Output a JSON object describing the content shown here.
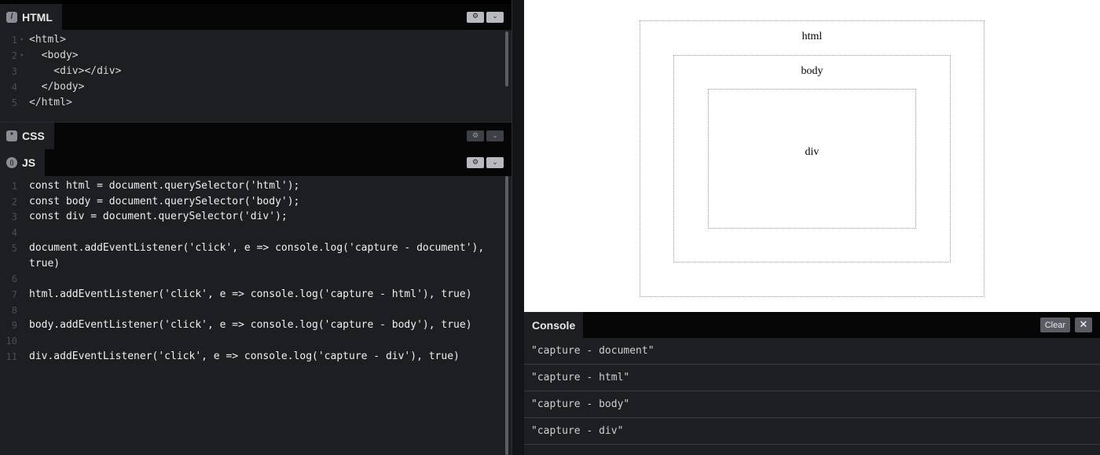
{
  "editors": {
    "html": {
      "tab_label": "HTML",
      "tab_icon": "/",
      "lines": [
        {
          "n": "1",
          "fold": "▾",
          "text": "<html>"
        },
        {
          "n": "2",
          "fold": "▾",
          "text": "  <body>"
        },
        {
          "n": "3",
          "fold": "",
          "text": "    <div></div>"
        },
        {
          "n": "4",
          "fold": "",
          "text": "  </body>"
        },
        {
          "n": "5",
          "fold": "",
          "text": "</html>"
        }
      ]
    },
    "css": {
      "tab_label": "CSS",
      "tab_icon": "*"
    },
    "js": {
      "tab_label": "JS",
      "tab_icon": "()",
      "lines": [
        {
          "n": "1",
          "text": "const html = document.querySelector('html');"
        },
        {
          "n": "2",
          "text": "const body = document.querySelector('body');"
        },
        {
          "n": "3",
          "text": "const div = document.querySelector('div');"
        },
        {
          "n": "4",
          "text": ""
        },
        {
          "n": "5",
          "text": "document.addEventListener('click', e => console.log('capture - document'),"
        },
        {
          "n": "",
          "text": "true)"
        },
        {
          "n": "6",
          "text": ""
        },
        {
          "n": "7",
          "text": "html.addEventListener('click', e => console.log('capture - html'), true)"
        },
        {
          "n": "8",
          "text": ""
        },
        {
          "n": "9",
          "text": "body.addEventListener('click', e => console.log('capture - body'), true)"
        },
        {
          "n": "10",
          "text": ""
        },
        {
          "n": "11",
          "text": "div.addEventListener('click', e => console.log('capture - div'), true)"
        }
      ]
    },
    "buttons": {
      "settings_icon": "⚙",
      "collapse_icon": "⌄"
    }
  },
  "preview": {
    "html_label": "html",
    "body_label": "body",
    "div_label": "div"
  },
  "console": {
    "title": "Console",
    "clear_label": "Clear",
    "close_label": "✕",
    "rows": [
      "\"capture - document\"",
      "\"capture - html\"",
      "\"capture - body\"",
      "\"capture - div\""
    ]
  }
}
